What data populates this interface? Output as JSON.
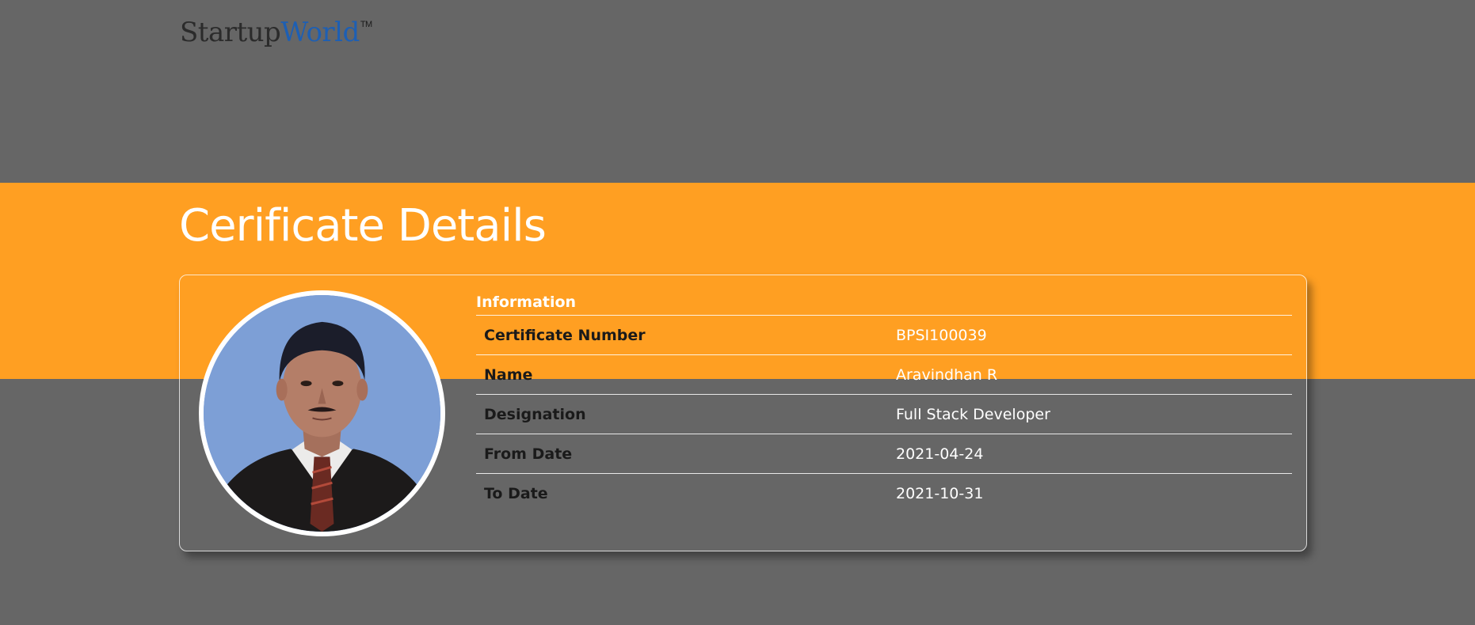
{
  "header": {
    "logo": {
      "part1": "Startup",
      "part2": "World",
      "trademark": "TM"
    }
  },
  "page": {
    "title": "Cerificate Details"
  },
  "info": {
    "heading": "Information",
    "rows": [
      {
        "label": "Certificate Number",
        "value": "BPSI100039"
      },
      {
        "label": "Name",
        "value": "Aravindhan R"
      },
      {
        "label": "Designation",
        "value": "Full Stack Developer"
      },
      {
        "label": "From Date",
        "value": "2021-04-24"
      },
      {
        "label": "To Date",
        "value": "2021-10-31"
      }
    ]
  },
  "colors": {
    "background": "#666666",
    "accent_band": "#ff9f22",
    "logo_dark": "#2b2b2b",
    "logo_blue": "#1d5fb4",
    "text_light": "#ffffff",
    "label_dark": "#1a1a1a"
  },
  "icons": {
    "avatar": "profile-photo"
  }
}
